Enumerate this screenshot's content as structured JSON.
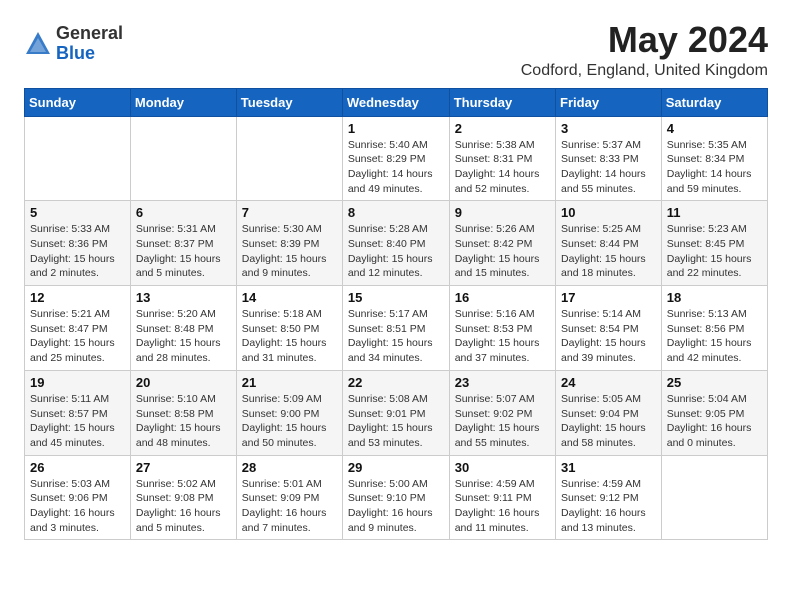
{
  "header": {
    "logo_line1": "General",
    "logo_line2": "Blue",
    "month_title": "May 2024",
    "location": "Codford, England, United Kingdom"
  },
  "days_of_week": [
    "Sunday",
    "Monday",
    "Tuesday",
    "Wednesday",
    "Thursday",
    "Friday",
    "Saturday"
  ],
  "weeks": [
    [
      {
        "day": "",
        "info": ""
      },
      {
        "day": "",
        "info": ""
      },
      {
        "day": "",
        "info": ""
      },
      {
        "day": "1",
        "info": "Sunrise: 5:40 AM\nSunset: 8:29 PM\nDaylight: 14 hours\nand 49 minutes."
      },
      {
        "day": "2",
        "info": "Sunrise: 5:38 AM\nSunset: 8:31 PM\nDaylight: 14 hours\nand 52 minutes."
      },
      {
        "day": "3",
        "info": "Sunrise: 5:37 AM\nSunset: 8:33 PM\nDaylight: 14 hours\nand 55 minutes."
      },
      {
        "day": "4",
        "info": "Sunrise: 5:35 AM\nSunset: 8:34 PM\nDaylight: 14 hours\nand 59 minutes."
      }
    ],
    [
      {
        "day": "5",
        "info": "Sunrise: 5:33 AM\nSunset: 8:36 PM\nDaylight: 15 hours\nand 2 minutes."
      },
      {
        "day": "6",
        "info": "Sunrise: 5:31 AM\nSunset: 8:37 PM\nDaylight: 15 hours\nand 5 minutes."
      },
      {
        "day": "7",
        "info": "Sunrise: 5:30 AM\nSunset: 8:39 PM\nDaylight: 15 hours\nand 9 minutes."
      },
      {
        "day": "8",
        "info": "Sunrise: 5:28 AM\nSunset: 8:40 PM\nDaylight: 15 hours\nand 12 minutes."
      },
      {
        "day": "9",
        "info": "Sunrise: 5:26 AM\nSunset: 8:42 PM\nDaylight: 15 hours\nand 15 minutes."
      },
      {
        "day": "10",
        "info": "Sunrise: 5:25 AM\nSunset: 8:44 PM\nDaylight: 15 hours\nand 18 minutes."
      },
      {
        "day": "11",
        "info": "Sunrise: 5:23 AM\nSunset: 8:45 PM\nDaylight: 15 hours\nand 22 minutes."
      }
    ],
    [
      {
        "day": "12",
        "info": "Sunrise: 5:21 AM\nSunset: 8:47 PM\nDaylight: 15 hours\nand 25 minutes."
      },
      {
        "day": "13",
        "info": "Sunrise: 5:20 AM\nSunset: 8:48 PM\nDaylight: 15 hours\nand 28 minutes."
      },
      {
        "day": "14",
        "info": "Sunrise: 5:18 AM\nSunset: 8:50 PM\nDaylight: 15 hours\nand 31 minutes."
      },
      {
        "day": "15",
        "info": "Sunrise: 5:17 AM\nSunset: 8:51 PM\nDaylight: 15 hours\nand 34 minutes."
      },
      {
        "day": "16",
        "info": "Sunrise: 5:16 AM\nSunset: 8:53 PM\nDaylight: 15 hours\nand 37 minutes."
      },
      {
        "day": "17",
        "info": "Sunrise: 5:14 AM\nSunset: 8:54 PM\nDaylight: 15 hours\nand 39 minutes."
      },
      {
        "day": "18",
        "info": "Sunrise: 5:13 AM\nSunset: 8:56 PM\nDaylight: 15 hours\nand 42 minutes."
      }
    ],
    [
      {
        "day": "19",
        "info": "Sunrise: 5:11 AM\nSunset: 8:57 PM\nDaylight: 15 hours\nand 45 minutes."
      },
      {
        "day": "20",
        "info": "Sunrise: 5:10 AM\nSunset: 8:58 PM\nDaylight: 15 hours\nand 48 minutes."
      },
      {
        "day": "21",
        "info": "Sunrise: 5:09 AM\nSunset: 9:00 PM\nDaylight: 15 hours\nand 50 minutes."
      },
      {
        "day": "22",
        "info": "Sunrise: 5:08 AM\nSunset: 9:01 PM\nDaylight: 15 hours\nand 53 minutes."
      },
      {
        "day": "23",
        "info": "Sunrise: 5:07 AM\nSunset: 9:02 PM\nDaylight: 15 hours\nand 55 minutes."
      },
      {
        "day": "24",
        "info": "Sunrise: 5:05 AM\nSunset: 9:04 PM\nDaylight: 15 hours\nand 58 minutes."
      },
      {
        "day": "25",
        "info": "Sunrise: 5:04 AM\nSunset: 9:05 PM\nDaylight: 16 hours\nand 0 minutes."
      }
    ],
    [
      {
        "day": "26",
        "info": "Sunrise: 5:03 AM\nSunset: 9:06 PM\nDaylight: 16 hours\nand 3 minutes."
      },
      {
        "day": "27",
        "info": "Sunrise: 5:02 AM\nSunset: 9:08 PM\nDaylight: 16 hours\nand 5 minutes."
      },
      {
        "day": "28",
        "info": "Sunrise: 5:01 AM\nSunset: 9:09 PM\nDaylight: 16 hours\nand 7 minutes."
      },
      {
        "day": "29",
        "info": "Sunrise: 5:00 AM\nSunset: 9:10 PM\nDaylight: 16 hours\nand 9 minutes."
      },
      {
        "day": "30",
        "info": "Sunrise: 4:59 AM\nSunset: 9:11 PM\nDaylight: 16 hours\nand 11 minutes."
      },
      {
        "day": "31",
        "info": "Sunrise: 4:59 AM\nSunset: 9:12 PM\nDaylight: 16 hours\nand 13 minutes."
      },
      {
        "day": "",
        "info": ""
      }
    ]
  ]
}
